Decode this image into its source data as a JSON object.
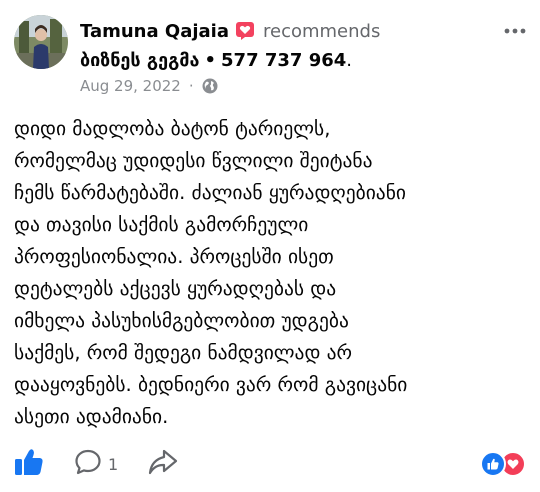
{
  "author": {
    "name": "Tamuna Qajaia",
    "action": "recommends"
  },
  "page": {
    "name": "ბიზნეს გეგმა",
    "phone": "577 737 964",
    "separator": "•",
    "period": "."
  },
  "meta": {
    "date": "Aug 29, 2022",
    "dot": "·",
    "privacy_icon": "globe-icon"
  },
  "menu_icon": "more-options-icon",
  "body": {
    "lines": [
      "დიდი მადლობა ბატონ ტარიელს,",
      "რომელმაც უდიდესი წვლილი შეიტანა",
      "ჩემს წარმატებაში. ძალიან ყურადღებიანი",
      "და თავისი საქმის გამორჩეული",
      "პროფესიონალია. პროცესში ისეთ",
      "დეტალებს აქცევს ყურადღებას და",
      "იმხელა პასუხისმგებლობით უდგება",
      "საქმეს, რომ შედეგი ნამდვილად არ",
      "დააყოვნებს. ბედნიერი ვარ რომ გავიცანი",
      "ასეთი ადამიანი."
    ]
  },
  "actions": {
    "comment_count": "1",
    "like_icon": "thumbs-up-icon",
    "comment_icon": "comment-icon",
    "share_icon": "share-icon"
  },
  "reactions": [
    "like",
    "love"
  ],
  "colors": {
    "accent": "#1877f2",
    "love": "#f33e58",
    "recommend_badge": "#f3425f",
    "secondary_text": "#65676b"
  }
}
